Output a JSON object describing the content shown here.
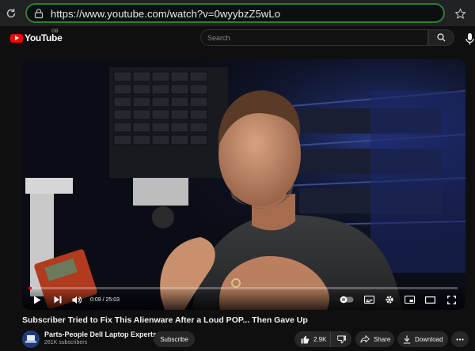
{
  "browser": {
    "url": "https://www.youtube.com/watch?v=0wyybzZ5wLo"
  },
  "header": {
    "logo_text": "YouTube",
    "region": "GB",
    "search_placeholder": "Search"
  },
  "player": {
    "current_time": "0:09",
    "duration": "25:03",
    "time_display": "0:09 / 25:03",
    "progress_fraction": 0.006,
    "autoplay_on": false
  },
  "video": {
    "title": "Subscriber Tried to Fix This Alienware After a Loud POP... Then Gave Up"
  },
  "channel": {
    "name": "Parts-People Dell Laptop Experts",
    "subscribers": "261K subscribers",
    "subscribe_label": "Subscribe"
  },
  "actions": {
    "like_count": "2.9K",
    "share_label": "Share",
    "download_label": "Download"
  },
  "colors": {
    "accent": "#ff0000",
    "background": "#0f0f0f",
    "pill": "#272727",
    "url_border": "#2e7d32"
  },
  "icons": [
    "reload-icon",
    "lock-icon",
    "star-icon",
    "youtube-logo",
    "search-icon",
    "mic-icon",
    "play-icon",
    "next-icon",
    "volume-icon",
    "autoplay-toggle",
    "subtitles-icon",
    "settings-icon",
    "miniplayer-icon",
    "theater-icon",
    "fullscreen-icon",
    "like-icon",
    "dislike-icon",
    "share-icon",
    "download-icon",
    "more-icon"
  ]
}
